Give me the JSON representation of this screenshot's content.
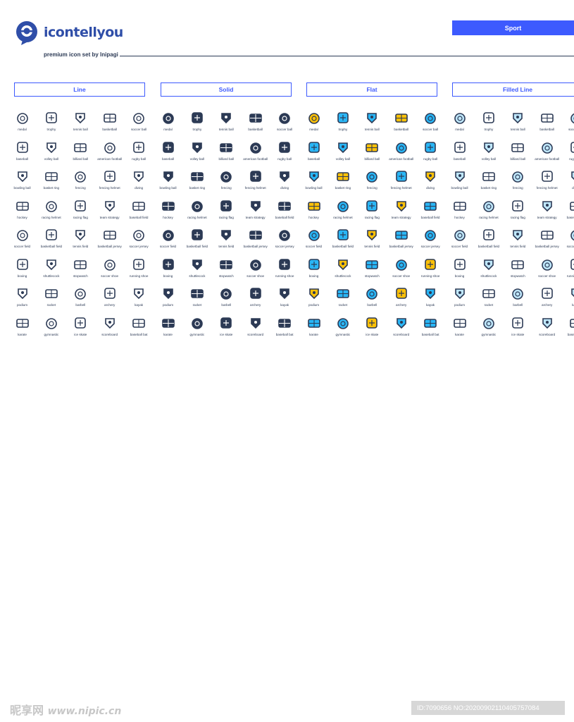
{
  "brand": {
    "name": "icontellyou",
    "subtitle": "premium icon set by lnipagi",
    "color": "#2f4ea8"
  },
  "header": {
    "category_button": "Sport",
    "accent": "#3d5afe"
  },
  "tabs": [
    "Line",
    "Solid",
    "Flat",
    "Filled Line"
  ],
  "icons": [
    [
      "medal",
      "trophy",
      "tennis ball",
      "basketball",
      "soccer ball"
    ],
    [
      "baseball",
      "volley ball",
      "billiard ball",
      "american football",
      "rugby ball"
    ],
    [
      "bowling ball",
      "basket ring",
      "fencing",
      "fencing helmet",
      "diving"
    ],
    [
      "hockey",
      "racing helmet",
      "racing flag",
      "team strategy",
      "baseball field"
    ],
    [
      "soccer field",
      "basketball field",
      "tennis field",
      "basketball jersey",
      "soccer jersey"
    ],
    [
      "boxing",
      "shuttlecock",
      "stopwatch",
      "soccer shoe",
      "running shoe"
    ],
    [
      "podium",
      "racket",
      "barbell",
      "archery",
      "kayak"
    ],
    [
      "karate",
      "gymnastic",
      "ice skate",
      "scoreboard",
      "baseball bat"
    ]
  ],
  "icon_glyphs": [
    "medal-icon",
    "trophy-icon",
    "tennis-ball-icon",
    "basketball-icon",
    "soccer-ball-icon",
    "baseball-icon",
    "volley-ball-icon",
    "billiard-ball-icon",
    "american-football-icon",
    "rugby-ball-icon",
    "bowling-ball-icon",
    "basket-ring-icon",
    "fencing-icon",
    "fencing-helmet-icon",
    "diving-icon",
    "hockey-icon",
    "racing-helmet-icon",
    "racing-flag-icon",
    "team-strategy-icon",
    "baseball-field-icon",
    "soccer-field-icon",
    "basketball-field-icon",
    "tennis-field-icon",
    "basketball-jersey-icon",
    "soccer-jersey-icon",
    "boxing-icon",
    "shuttlecock-icon",
    "stopwatch-icon",
    "soccer-shoe-icon",
    "running-shoe-icon",
    "podium-icon",
    "racket-icon",
    "barbell-icon",
    "archery-icon",
    "kayak-icon",
    "karate-icon",
    "gymnastic-icon",
    "ice-skate-icon",
    "scoreboard-icon",
    "baseball-bat-icon"
  ],
  "colors": {
    "outline": "#2c3a55",
    "flat_blue": "#29b6f6",
    "flat_yellow": "#ffc107"
  },
  "footer": {
    "watermark": "昵享网",
    "url": "www.nipic.cn",
    "id_text": "ID:7090656 NO:20200902110405757084"
  }
}
